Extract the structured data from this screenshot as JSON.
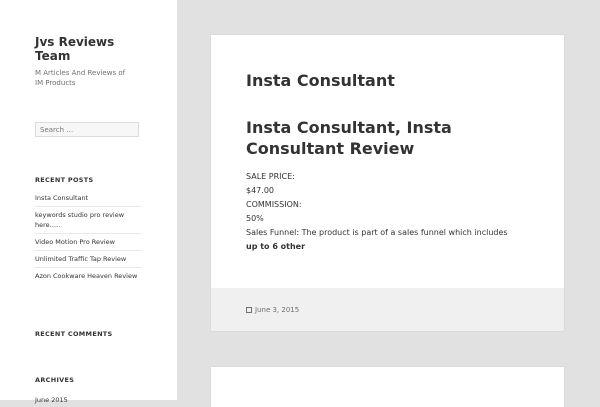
{
  "site": {
    "title": "Jvs Reviews Team",
    "description": "M Articles And Reviews of IM Products"
  },
  "search": {
    "placeholder": "Search …"
  },
  "recent_posts": {
    "heading": "RECENT POSTS",
    "items": [
      {
        "label": "Insta Consultant"
      },
      {
        "label": "keywords studio pro review here….."
      },
      {
        "label": "Video Motion Pro Review"
      },
      {
        "label": "Unlimited Traffic Tap Review"
      },
      {
        "label": "Azon Cookware Heaven Review"
      }
    ]
  },
  "recent_comments": {
    "heading": "RECENT COMMENTS"
  },
  "archives": {
    "heading": "ARCHIVES",
    "first_item": "June 2015"
  },
  "post": {
    "title": "Insta Consultant",
    "subtitle": "Insta Consultant, Insta Consultant Review",
    "lines": [
      "SALE PRICE:",
      "$47.00",
      "COMMISSION:",
      "50%",
      "Sales Funnel: The product is part of a sales funnel which includes"
    ],
    "bold_line": "up to 6 other",
    "date": "June 3, 2015"
  }
}
